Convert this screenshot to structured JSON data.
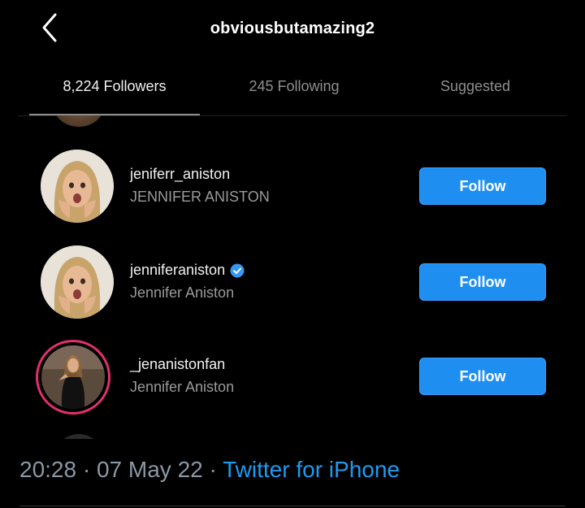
{
  "header": {
    "title": "obviousbutamazing2",
    "back_icon": "chevron-left-icon"
  },
  "tabs": [
    {
      "label": "8,224 Followers",
      "active": true
    },
    {
      "label": "245 Following",
      "active": false
    },
    {
      "label": "Suggested",
      "active": false
    }
  ],
  "rows": [
    {
      "username": "jeniferr_aniston",
      "full_name": "JENNIFER ANISTON",
      "verified": false,
      "story_ring": false,
      "button": "Follow"
    },
    {
      "username": "jenniferaniston",
      "full_name": "Jennifer Aniston",
      "verified": true,
      "story_ring": false,
      "button": "Follow"
    },
    {
      "username": "_jenanistonfan",
      "full_name": "Jennifer Aniston",
      "verified": false,
      "story_ring": true,
      "button": "Follow"
    }
  ],
  "footer": {
    "time": "20:28",
    "sep1": " · ",
    "date": "07 May 22",
    "sep2": " · ",
    "source": "Twitter for iPhone"
  },
  "colors": {
    "background": "#000000",
    "follow_button": "#1f8ef1",
    "verified_badge": "#3897f0",
    "link": "#1d9bf0",
    "story_ring": "#e1306c"
  }
}
